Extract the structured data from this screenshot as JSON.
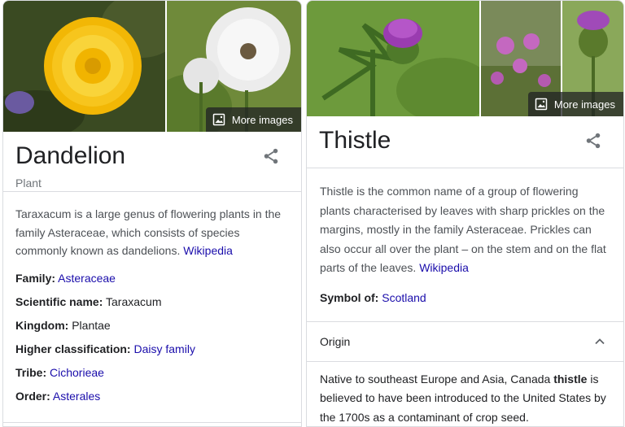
{
  "dandelion": {
    "title": "Dandelion",
    "subtitle": "Plant",
    "more_images": "More images",
    "description": "Taraxacum is a large genus of flowering plants in the family Asteraceae, which consists of species commonly known as dandelions. ",
    "source_link": "Wikipedia",
    "facts": [
      {
        "label": "Family:",
        "value": "Asteraceae",
        "is_link": true
      },
      {
        "label": "Scientific name:",
        "value": "Taraxacum",
        "is_link": false
      },
      {
        "label": "Kingdom:",
        "value": "Plantae",
        "is_link": false
      },
      {
        "label": "Higher classification:",
        "value": "Daisy family",
        "is_link": true
      },
      {
        "label": "Tribe:",
        "value": "Cichorieae",
        "is_link": true
      },
      {
        "label": "Order:",
        "value": "Asterales",
        "is_link": true
      }
    ]
  },
  "thistle": {
    "title": "Thistle",
    "more_images": "More images",
    "description": "Thistle is the common name of a group of flowering plants characterised by leaves with sharp prickles on the margins, mostly in the family Asteraceae. Prickles can also occur all over the plant – on the stem and on the flat parts of the leaves. ",
    "source_link": "Wikipedia",
    "symbol_label": "Symbol of:",
    "symbol_value": "Scotland",
    "origin_label": "Origin",
    "origin_text_before": "Native to southeast Europe and Asia, Canada ",
    "origin_text_bold": "thistle",
    "origin_text_after": " is believed to have been introduced to the United States by the 1700s as a contaminant of crop seed."
  },
  "colors": {
    "link": "#1a0dab",
    "divider": "#dadce0",
    "muted": "#70757a"
  },
  "icons": {
    "share": "share-icon",
    "image": "image-icon",
    "chevron": "chevron-up-icon"
  }
}
